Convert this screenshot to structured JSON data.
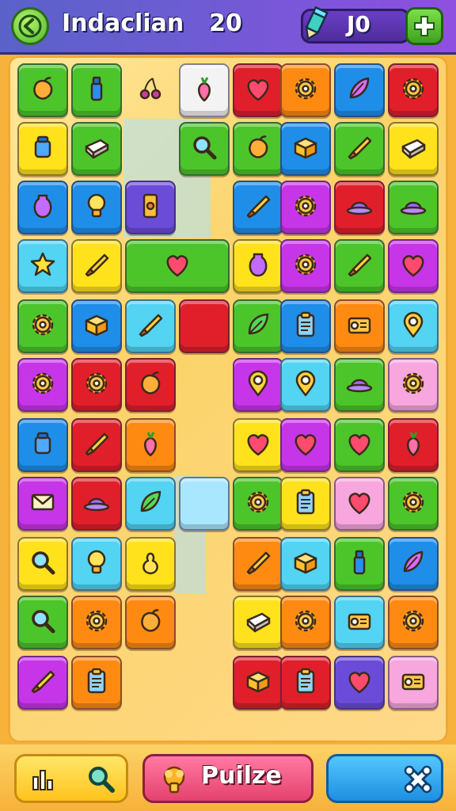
{
  "header": {
    "title": "Indaclian",
    "level": "20",
    "score": "J0"
  },
  "footer": {
    "puzzle_label": "Puilze"
  },
  "colors": {
    "red": "#e01f2a",
    "green": "#4cc52a",
    "yellow": "#ffe21c",
    "blue": "#1f8ee8",
    "cyan": "#52d4f2",
    "orange": "#ff8a12",
    "magenta": "#c735e8",
    "pink": "#f7a6de",
    "purple": "#6b4cd8",
    "lightblue": "#a9e7ff",
    "white": "#f3f3f3"
  },
  "board": {
    "tiles": [
      {
        "c": "green",
        "icon": "fruit-icon"
      },
      {
        "c": "green",
        "icon": "bottle-icon"
      },
      {
        "c": "none",
        "icon": "cherry-icon"
      },
      {
        "c": "white",
        "icon": "radish-icon"
      },
      {
        "c": "red",
        "icon": "heart-icon"
      },
      {
        "c": "orange",
        "icon": "gear-icon"
      },
      {
        "c": "blue",
        "icon": "feather-icon"
      },
      {
        "c": "red",
        "icon": "gear-icon"
      },
      {
        "c": "yellow",
        "icon": "jar-icon"
      },
      {
        "c": "green",
        "icon": "soap-icon"
      },
      {
        "c": "gap",
        "icon": ""
      },
      {
        "c": "green",
        "icon": "magnifier-icon"
      },
      {
        "c": "green",
        "icon": "fruit-icon"
      },
      {
        "c": "blue",
        "icon": "box-icon"
      },
      {
        "c": "green",
        "icon": "brush-icon"
      },
      {
        "c": "yellow",
        "icon": "soap-icon"
      },
      {
        "c": "blue",
        "icon": "vase-icon"
      },
      {
        "c": "blue",
        "icon": "bulb-icon"
      },
      {
        "c": "purple",
        "icon": "phone-icon"
      },
      {
        "c": "gap",
        "icon": ""
      },
      {
        "c": "blue",
        "icon": "brush-icon"
      },
      {
        "c": "magenta",
        "icon": "gear-icon"
      },
      {
        "c": "red",
        "icon": "hat-icon"
      },
      {
        "c": "green",
        "icon": "hat-icon"
      },
      {
        "c": "cyan",
        "icon": "star-icon"
      },
      {
        "c": "yellow",
        "icon": "brush-icon"
      },
      {
        "c": "green",
        "icon": "heart-icon"
      },
      {
        "c": "gap",
        "icon": ""
      },
      {
        "c": "yellow",
        "icon": "vase-icon"
      },
      {
        "c": "magenta",
        "icon": "gear-icon"
      },
      {
        "c": "green",
        "icon": "brush-icon"
      },
      {
        "c": "magenta",
        "icon": "heart-icon"
      },
      {
        "c": "green",
        "icon": "gear-icon"
      },
      {
        "c": "blue",
        "icon": "box-icon"
      },
      {
        "c": "cyan",
        "icon": "brush-icon"
      },
      {
        "c": "red",
        "icon": ""
      },
      {
        "c": "green",
        "icon": "leaf-icon"
      },
      {
        "c": "blue",
        "icon": "clipboard-icon"
      },
      {
        "c": "orange",
        "icon": "radio-icon"
      },
      {
        "c": "cyan",
        "icon": "pin-icon"
      },
      {
        "c": "magenta",
        "icon": "gear-icon"
      },
      {
        "c": "red",
        "icon": "gear-icon"
      },
      {
        "c": "red",
        "icon": "fruit-icon"
      },
      {
        "c": "gap",
        "icon": ""
      },
      {
        "c": "magenta",
        "icon": "pin-icon"
      },
      {
        "c": "cyan",
        "icon": "pin-icon"
      },
      {
        "c": "green",
        "icon": "hat-icon"
      },
      {
        "c": "pink",
        "icon": "gear-icon"
      },
      {
        "c": "blue",
        "icon": "jar-icon"
      },
      {
        "c": "red",
        "icon": "brush-icon"
      },
      {
        "c": "orange",
        "icon": "radish-icon"
      },
      {
        "c": "gap",
        "icon": ""
      },
      {
        "c": "yellow",
        "icon": "heart-icon"
      },
      {
        "c": "magenta",
        "icon": "heart-icon"
      },
      {
        "c": "green",
        "icon": "heart-icon"
      },
      {
        "c": "red",
        "icon": "radish-icon"
      },
      {
        "c": "magenta",
        "icon": "envelope-icon"
      },
      {
        "c": "red",
        "icon": "hat-icon"
      },
      {
        "c": "cyan",
        "icon": "leaf-icon"
      },
      {
        "c": "lightblue",
        "icon": ""
      },
      {
        "c": "green",
        "icon": "gear-icon"
      },
      {
        "c": "yellow",
        "icon": "clipboard-icon"
      },
      {
        "c": "pink",
        "icon": "heart-icon"
      },
      {
        "c": "green",
        "icon": "gear-icon"
      },
      {
        "c": "yellow",
        "icon": "magnifier-icon"
      },
      {
        "c": "cyan",
        "icon": "bulb-icon"
      },
      {
        "c": "yellow",
        "icon": "pear-icon"
      },
      {
        "c": "gap",
        "icon": ""
      },
      {
        "c": "orange",
        "icon": "brush-icon"
      },
      {
        "c": "cyan",
        "icon": "box-icon"
      },
      {
        "c": "green",
        "icon": "bottle-icon"
      },
      {
        "c": "blue",
        "icon": "feather-icon"
      },
      {
        "c": "green",
        "icon": "magnifier-icon"
      },
      {
        "c": "orange",
        "icon": "gear-icon"
      },
      {
        "c": "orange",
        "icon": "fruit-icon"
      },
      {
        "c": "gap",
        "icon": ""
      },
      {
        "c": "yellow",
        "icon": "soap-icon"
      },
      {
        "c": "orange",
        "icon": "gear-icon"
      },
      {
        "c": "cyan",
        "icon": "radio-icon"
      },
      {
        "c": "orange",
        "icon": "gear-icon"
      },
      {
        "c": "magenta",
        "icon": "brush-icon"
      },
      {
        "c": "orange",
        "icon": "clipboard-icon"
      },
      {
        "c": "gap",
        "icon": ""
      },
      {
        "c": "gap",
        "icon": ""
      },
      {
        "c": "red",
        "icon": "box-icon"
      },
      {
        "c": "red",
        "icon": "clipboard-icon"
      },
      {
        "c": "purple",
        "icon": "heart-icon"
      },
      {
        "c": "pink",
        "icon": "radio-icon"
      }
    ]
  }
}
